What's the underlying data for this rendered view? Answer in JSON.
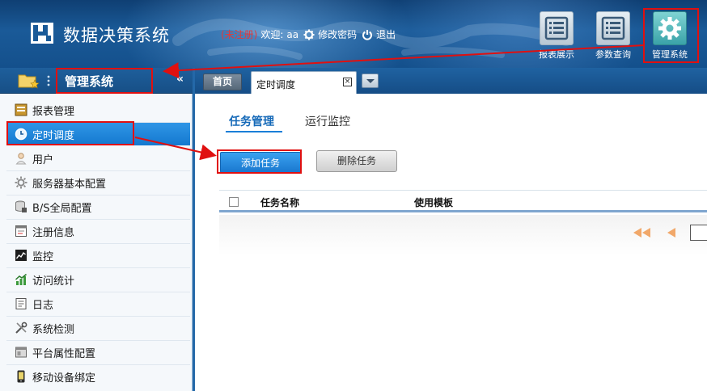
{
  "header": {
    "app_title": "数据决策系统",
    "unregistered": "(未注册)",
    "welcome": "欢迎:",
    "username": "aa",
    "change_password": "修改密码",
    "logout": "退出",
    "nav_buttons": [
      {
        "label": "报表展示",
        "icon": "list-icon"
      },
      {
        "label": "参数查询",
        "icon": "list-icon"
      },
      {
        "label": "管理系统",
        "icon": "gear-icon"
      }
    ]
  },
  "sidebar": {
    "title": "管理系统",
    "collapse_glyph": "«",
    "items": [
      {
        "label": "报表管理",
        "icon": "report-icon"
      },
      {
        "label": "定时调度",
        "icon": "clock-icon",
        "active": true
      },
      {
        "label": "用户",
        "icon": "user-icon"
      },
      {
        "label": "服务器基本配置",
        "icon": "settings-gear-icon"
      },
      {
        "label": "B/S全局配置",
        "icon": "database-icon"
      },
      {
        "label": "注册信息",
        "icon": "registration-icon"
      },
      {
        "label": "监控",
        "icon": "monitor-chart-icon"
      },
      {
        "label": "访问统计",
        "icon": "statistics-icon"
      },
      {
        "label": "日志",
        "icon": "log-icon"
      },
      {
        "label": "系统检测",
        "icon": "tools-icon"
      },
      {
        "label": "平台属性配置",
        "icon": "platform-icon"
      },
      {
        "label": "移动设备绑定",
        "icon": "mobile-device-icon"
      }
    ]
  },
  "tabs": {
    "home": "首页",
    "current": "定时调度",
    "close_glyph": "×"
  },
  "main": {
    "subtabs": [
      "任务管理",
      "运行监控"
    ],
    "add_button": "添加任务",
    "delete_button": "删除任务",
    "table": {
      "columns": [
        "任务名称",
        "使用模板"
      ],
      "rows": []
    }
  },
  "colors": {
    "header_blue": "#1a5a98",
    "active_blue": "#1478cf",
    "annotation_red": "#e01010"
  }
}
